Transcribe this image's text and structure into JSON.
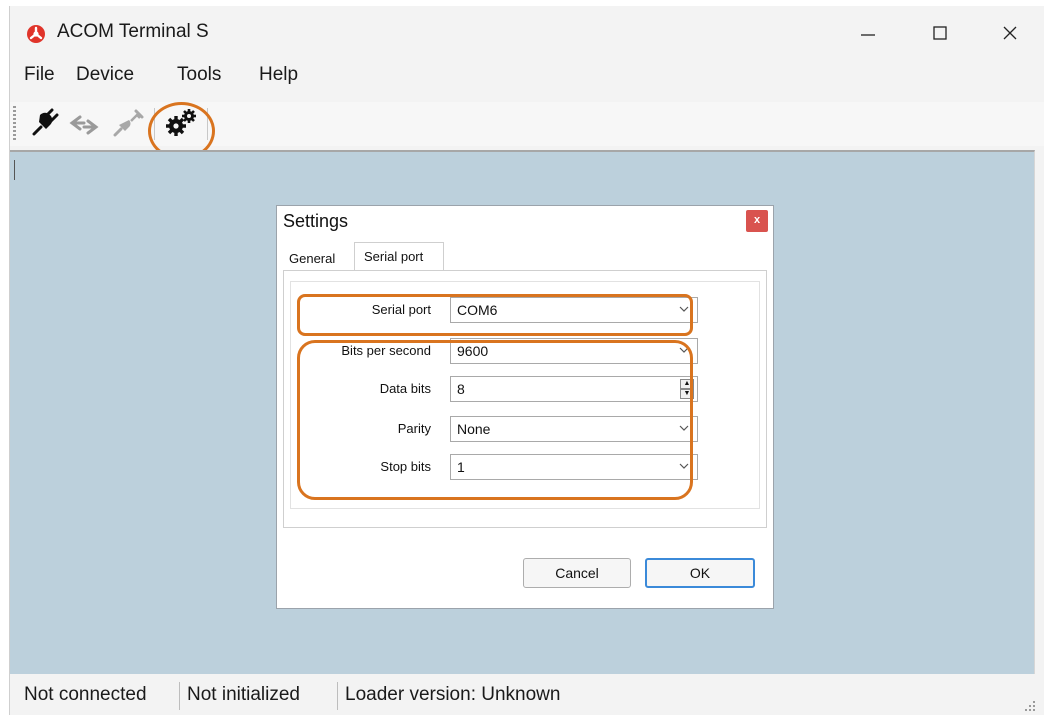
{
  "window": {
    "title": "ACOM Terminal S",
    "controls": {
      "minimize": "—",
      "maximize": "☐",
      "close": "✕"
    }
  },
  "menu": {
    "items": [
      "File",
      "Device",
      "Tools",
      "Help"
    ]
  },
  "toolbar": {
    "buttons": [
      {
        "icon": "plug-connect-icon"
      },
      {
        "icon": "refresh-arrows-icon"
      },
      {
        "icon": "plug-disconnect-icon"
      },
      {
        "icon": "settings-gears-icon"
      }
    ]
  },
  "dialog": {
    "title": "Settings",
    "close_label": "x",
    "tabs": [
      "General",
      "Serial port"
    ],
    "active_tab": "Serial port",
    "fields": {
      "serial_port": {
        "label": "Serial port",
        "value": "COM6"
      },
      "bits_per_second": {
        "label": "Bits per second",
        "value": "9600"
      },
      "data_bits": {
        "label": "Data bits",
        "value": "8"
      },
      "parity": {
        "label": "Parity",
        "value": "None"
      },
      "stop_bits": {
        "label": "Stop bits",
        "value": "1"
      }
    },
    "buttons": {
      "cancel": "Cancel",
      "ok": "OK"
    }
  },
  "status": {
    "connection": "Not connected",
    "init": "Not initialized",
    "loader": "Loader version: Unknown"
  },
  "colors": {
    "workspace": "#bcd0dc",
    "annotation": "#d9741f",
    "logo": "#e0342a",
    "ok_focus": "#3b8ad9"
  }
}
